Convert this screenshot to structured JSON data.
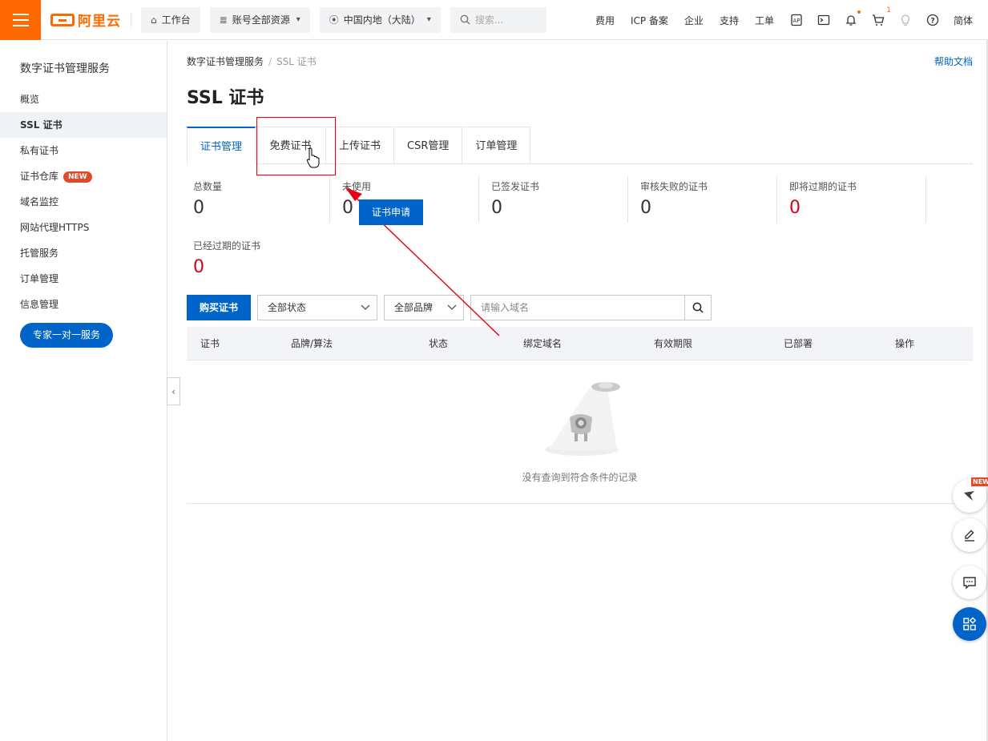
{
  "topbar": {
    "logo_text": "阿里云",
    "workbench": "工作台",
    "resources": "账号全部资源",
    "region": "中国内地（大陆）",
    "search_placeholder": "搜索...",
    "links": [
      "费用",
      "ICP 备案",
      "企业",
      "支持",
      "工单"
    ],
    "cart_count": "1",
    "language": "简体",
    "accent": "#ff6a00"
  },
  "sidebar": {
    "title": "数字证书管理服务",
    "items": [
      {
        "label": "概览"
      },
      {
        "label": "SSL 证书"
      },
      {
        "label": "私有证书"
      },
      {
        "label": "证书仓库",
        "badge": "NEW"
      },
      {
        "label": "域名监控"
      },
      {
        "label": "网站代理HTTPS"
      },
      {
        "label": "托管服务"
      },
      {
        "label": "订单管理"
      },
      {
        "label": "信息管理"
      }
    ],
    "expert_button": "专家一对一服务"
  },
  "breadcrumb": {
    "root": "数字证书管理服务",
    "current": "SSL 证书"
  },
  "help_link": "帮助文档",
  "page_title": "SSL 证书",
  "tabs": [
    "证书管理",
    "免费证书",
    "上传证书",
    "CSR管理",
    "订单管理"
  ],
  "stats": [
    {
      "label": "总数量",
      "value": "0"
    },
    {
      "label": "未使用",
      "value": "0"
    },
    {
      "label": "已签发证书",
      "value": "0"
    },
    {
      "label": "审核失败的证书",
      "value": "0"
    },
    {
      "label": "即将过期的证书",
      "value": "0"
    },
    {
      "label": "已经过期的证书",
      "value": "0"
    }
  ],
  "apply_button": "证书申请",
  "toolbar": {
    "buy_button": "购买证书",
    "status_select": "全部状态",
    "brand_select": "全部品牌",
    "domain_placeholder": "请输入域名"
  },
  "table": {
    "columns": [
      "证书",
      "品牌/算法",
      "状态",
      "绑定域名",
      "有效期限",
      "已部署",
      "操作"
    ],
    "empty_text": "没有查询到符合条件的记录"
  },
  "float_new_badge": "NEW",
  "primary_color": "#0064c8",
  "alert_color": "#d9001b"
}
